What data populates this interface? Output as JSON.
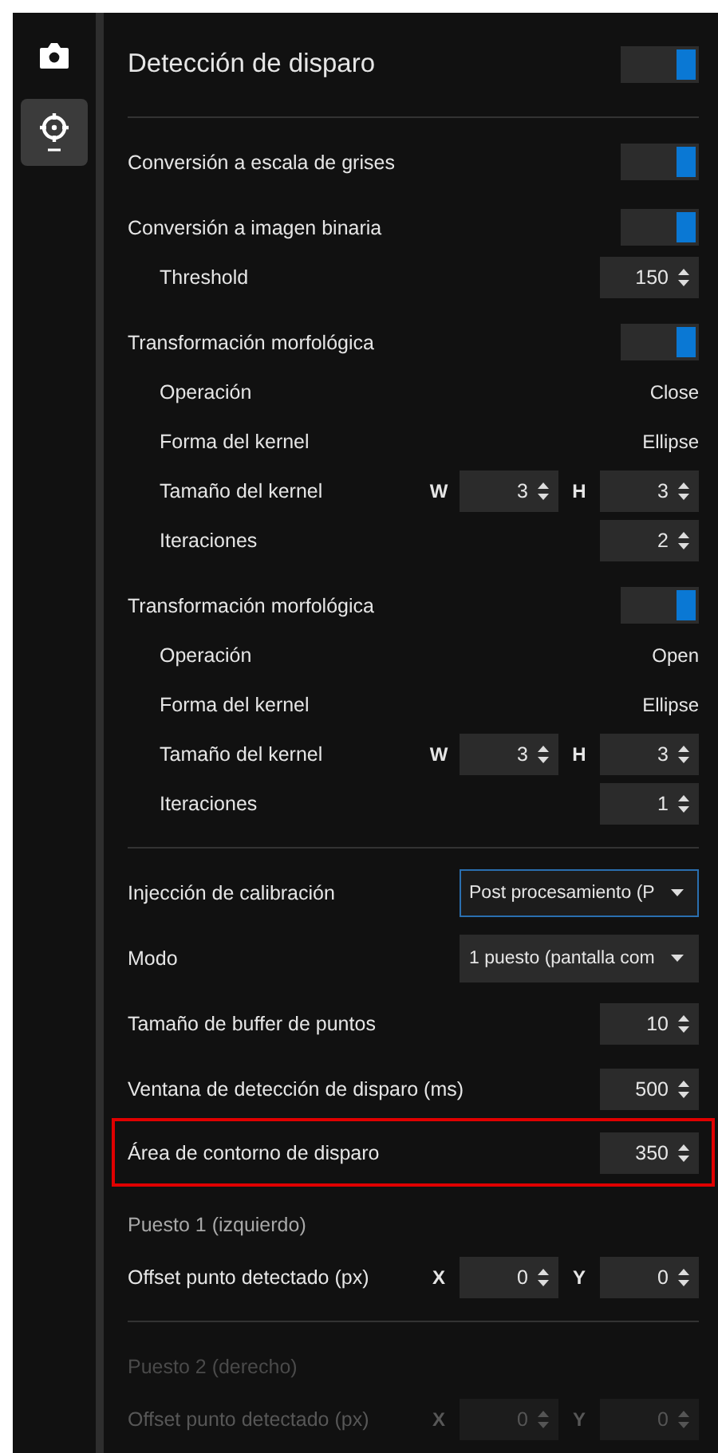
{
  "sidebar": {
    "items": [
      {
        "kind": "camera",
        "selected": false
      },
      {
        "kind": "target",
        "selected": true
      }
    ]
  },
  "header": {
    "title": "Detección de disparo",
    "on": true
  },
  "rows": [
    {
      "kind": "divider"
    },
    {
      "kind": "toggle",
      "label": "Conversión a escala de grises",
      "on": true
    },
    {
      "kind": "toggle",
      "label": "Conversión a imagen binaria",
      "on": true
    },
    {
      "kind": "number",
      "label": "Threshold",
      "indent": true,
      "value": "150"
    },
    {
      "kind": "toggle",
      "label": "Transformación morfológica",
      "on": true
    },
    {
      "kind": "text",
      "label": "Operación",
      "indent": true,
      "value": "Close"
    },
    {
      "kind": "text",
      "label": "Forma del kernel",
      "indent": true,
      "value": "Ellipse"
    },
    {
      "kind": "pair",
      "label": "Tamaño del kernel",
      "indent": true,
      "a_label": "W",
      "a": "3",
      "b_label": "H",
      "b": "3"
    },
    {
      "kind": "number",
      "label": "Iteraciones",
      "indent": true,
      "value": "2"
    },
    {
      "kind": "toggle",
      "label": "Transformación morfológica",
      "on": true
    },
    {
      "kind": "text",
      "label": "Operación",
      "indent": true,
      "value": "Open"
    },
    {
      "kind": "text",
      "label": "Forma del kernel",
      "indent": true,
      "value": "Ellipse"
    },
    {
      "kind": "pair",
      "label": "Tamaño del kernel",
      "indent": true,
      "a_label": "W",
      "a": "3",
      "b_label": "H",
      "b": "3"
    },
    {
      "kind": "number",
      "label": "Iteraciones",
      "indent": true,
      "value": "1"
    },
    {
      "kind": "divider"
    },
    {
      "kind": "select",
      "label": "Injección de calibración",
      "value": "Post procesamiento (P",
      "focused": true
    },
    {
      "kind": "select",
      "label": "Modo",
      "value": "1 puesto (pantalla com",
      "focused": false
    },
    {
      "kind": "number",
      "label": "Tamaño de buffer de puntos",
      "value": "10"
    },
    {
      "kind": "number",
      "label": "Ventana de detección de disparo (ms)",
      "value": "500"
    },
    {
      "kind": "number",
      "label": "Área de contorno de disparo",
      "value": "350",
      "highlighted": true
    },
    {
      "kind": "section",
      "label": "Puesto 1 (izquierdo)",
      "disabled": false
    },
    {
      "kind": "pair",
      "label": "Offset punto detectado (px)",
      "a_label": "X",
      "a": "0",
      "b_label": "Y",
      "b": "0",
      "disabled": false
    },
    {
      "kind": "divider"
    },
    {
      "kind": "section",
      "label": "Puesto 2 (derecho)",
      "disabled": true
    },
    {
      "kind": "pair",
      "label": "Offset punto detectado (px)",
      "a_label": "X",
      "a": "0",
      "b_label": "Y",
      "b": "0",
      "disabled": true
    }
  ]
}
